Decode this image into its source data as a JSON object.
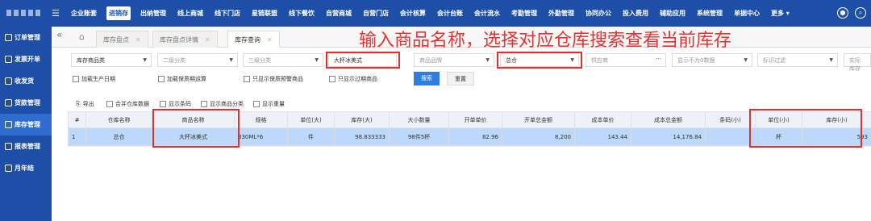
{
  "nav": [
    "企业账套",
    "进销存",
    "出纳管理",
    "线上商城",
    "线下门店",
    "星链联盟",
    "线下餐饮",
    "自营商城",
    "自营门店",
    "会计核算",
    "会计台账",
    "会计流水",
    "考勤管理",
    "外勤管理",
    "协同办公",
    "投入费用",
    "辅助应用",
    "系统管理",
    "单据中心",
    "更多"
  ],
  "active_nav": "进销存",
  "sidebar": [
    "订单管理",
    "发票开单",
    "收发货",
    "货款管理",
    "库存管理",
    "报表管理",
    "月年结"
  ],
  "active_sidebar": "库存管理",
  "tabs": [
    {
      "label": "库存盘点",
      "active": false
    },
    {
      "label": "库存盘点详情",
      "active": false
    },
    {
      "label": "库存查询",
      "active": true
    }
  ],
  "annotation": "输入商品名称，选择对应仓库搜索查看当前库存",
  "filters": {
    "category": "库存商品类",
    "sub2": "二级分类",
    "sub3": "三级分类",
    "product_name": "大杯冰美式",
    "brand": "商品品牌",
    "warehouse": "总仓",
    "supplier": "供应商",
    "show_zero": "显示不为0数据",
    "tag_filter": "标识过滤",
    "actual_stock": "实际库存"
  },
  "checks": [
    "加载生产日期",
    "加载保质期运算",
    "只显示保质预警商品",
    "只显示过期商品"
  ],
  "buttons": {
    "search": "搜索",
    "reset": "重置"
  },
  "toolbar": {
    "export": "导出",
    "opts": [
      "合并仓库数据",
      "显示条码",
      "显示商品分类",
      "显示重量"
    ]
  },
  "columns": [
    "#",
    "仓库名称",
    "商品名称",
    "规格",
    "单位(大)",
    "库存(大)",
    "大小数量",
    "开单单价",
    "开单总金额",
    "成本单价",
    "成本总金额",
    "条码(小)",
    "单位(小)",
    "库存(小)"
  ],
  "rows": [
    [
      "1",
      "总仓",
      "大杯冰美式",
      "330ML*6",
      "件",
      "98.833333",
      "98件5杯",
      "82.96",
      "8,200",
      "143.44",
      "14,176.84",
      "",
      "杯",
      "593"
    ]
  ]
}
